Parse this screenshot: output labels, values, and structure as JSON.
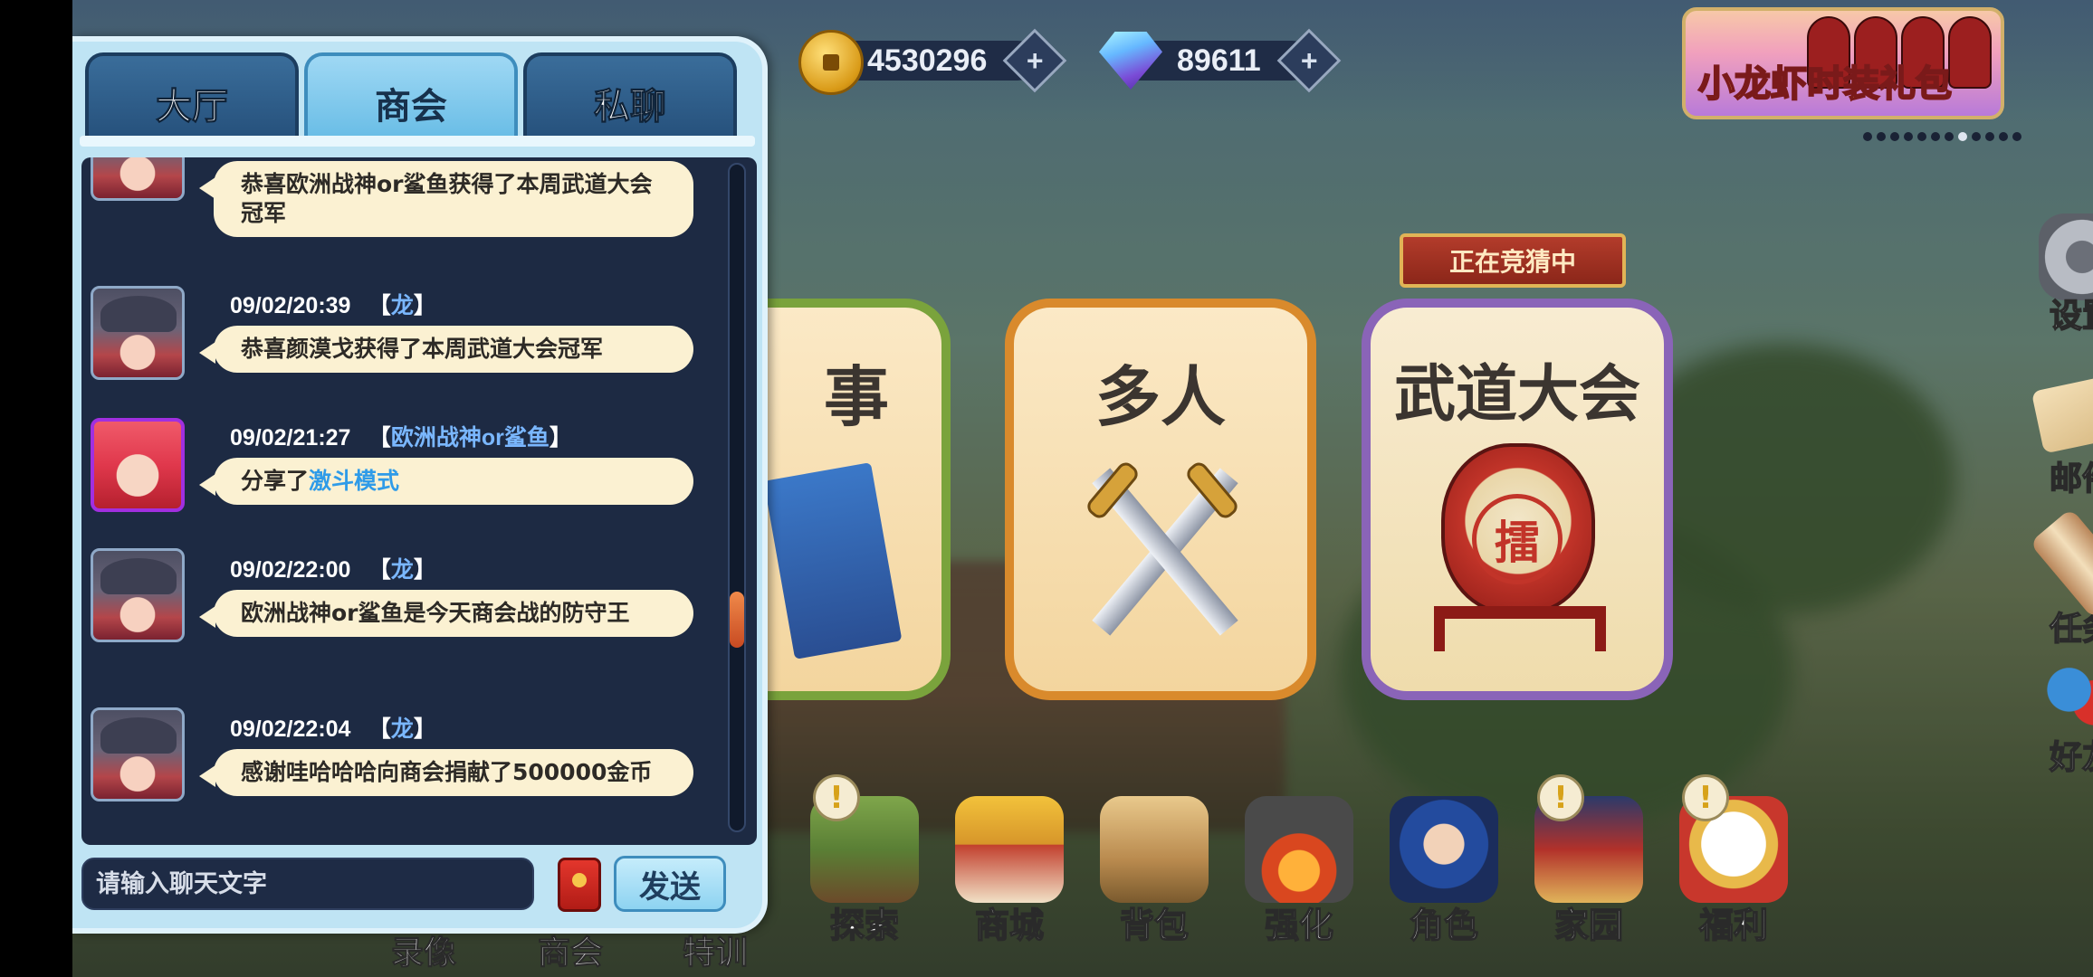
{
  "currencies": {
    "gold": {
      "icon": "gold-coin-icon",
      "value": "4530296"
    },
    "gems": {
      "icon": "diamond-gem-icon",
      "value": "89611"
    }
  },
  "banner": {
    "label": "小龙虾时装礼包"
  },
  "carousel": {
    "count": 12,
    "active_index": 7
  },
  "modes": {
    "partial_title": "事",
    "multi_title": "多人",
    "wudao_title": "武道大会",
    "wudao_badge": "正在竞猜中",
    "drum_char": "擂"
  },
  "side_menu": [
    {
      "label": "设置",
      "icon": "gear-icon"
    },
    {
      "label": "邮件",
      "icon": "mail-icon"
    },
    {
      "label": "任务",
      "icon": "scroll-icon"
    },
    {
      "label": "好友",
      "icon": "friends-icon"
    }
  ],
  "bottom_menu": [
    {
      "label": "探索",
      "icon": "explore-icon",
      "alert": true
    },
    {
      "label": "商城",
      "icon": "shop-icon",
      "alert": false
    },
    {
      "label": "背包",
      "icon": "backpack-icon",
      "alert": false
    },
    {
      "label": "强化",
      "icon": "forge-icon",
      "alert": false
    },
    {
      "label": "角色",
      "icon": "character-icon",
      "alert": false
    },
    {
      "label": "家园",
      "icon": "home-icon",
      "alert": true
    },
    {
      "label": "福利",
      "icon": "lucky-cat-icon",
      "alert": true
    }
  ],
  "bottom_hidden_labels": [
    "录像",
    "商会",
    "特训"
  ],
  "chat": {
    "tabs": [
      {
        "label": "大厅",
        "active": false
      },
      {
        "label": "商会",
        "active": true
      },
      {
        "label": "私聊",
        "active": false
      }
    ],
    "messages": [
      {
        "time": "",
        "sender": "",
        "text": "恭喜欧洲战神or鲨鱼获得了本周武道大会冠军",
        "link": ""
      },
      {
        "time": "09/02/20:39",
        "sender": "龙",
        "text": "恭喜颜漠戈获得了本周武道大会冠军",
        "link": ""
      },
      {
        "time": "09/02/21:27",
        "sender": "欧洲战神or鲨鱼",
        "text": "分享了",
        "link": "激斗模式"
      },
      {
        "time": "09/02/22:00",
        "sender": "龙",
        "text": "欧洲战神or鲨鱼是今天商会战的防守王",
        "link": ""
      },
      {
        "time": "09/02/22:04",
        "sender": "龙",
        "text": "感谢哇哈哈哈向商会捐献了500000金币",
        "link": ""
      }
    ],
    "input_placeholder": "请输入聊天文字",
    "send_label": "发送"
  }
}
